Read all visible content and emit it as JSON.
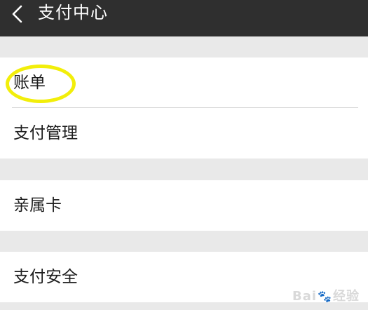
{
  "header": {
    "title": "支付中心",
    "back_icon": "chevron-left-icon"
  },
  "menu": {
    "group1": [
      {
        "label": "账单"
      },
      {
        "label": "支付管理"
      }
    ],
    "group2": [
      {
        "label": "亲属卡"
      }
    ],
    "group3": [
      {
        "label": "支付安全"
      }
    ]
  },
  "annotation": {
    "highlight_color": "#f2ee0a"
  },
  "watermark": {
    "text_left": "Bai",
    "text_right": "经验",
    "paw_icon": "paw-icon"
  },
  "colors": {
    "header_bg": "#2f2f2f",
    "page_bg": "#e9e9e9",
    "item_bg": "#ffffff",
    "item_text": "#1e1e1e"
  }
}
